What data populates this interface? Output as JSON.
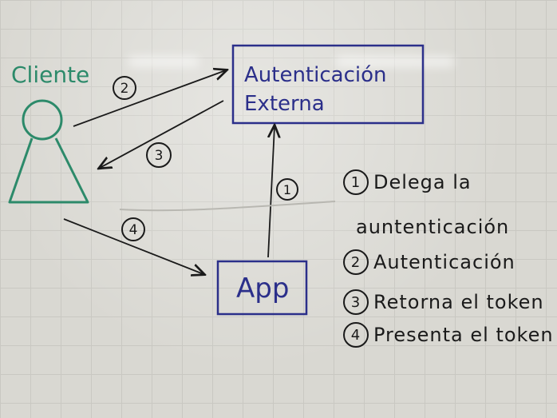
{
  "diagram": {
    "actor_label": "Cliente",
    "auth_box_line1": "Autenticación",
    "auth_box_line2": "Externa",
    "app_box_label": "App",
    "arrow_labels": [
      "2",
      "3",
      "1",
      "4"
    ]
  },
  "legend": [
    {
      "num": "1",
      "text": "Delega la",
      "text2": "auntenticación"
    },
    {
      "num": "2",
      "text": "Autenticación"
    },
    {
      "num": "3",
      "text": "Retorna el token"
    },
    {
      "num": "4",
      "text": "Presenta el token"
    }
  ],
  "colors": {
    "actor": "#2c8a6a",
    "boxes": "#2b2f8a",
    "ink": "#1a1a1a",
    "board": "#d9d8d2"
  }
}
